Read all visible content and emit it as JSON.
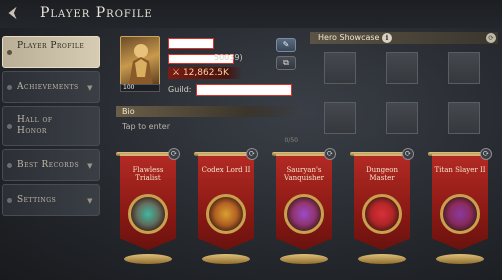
{
  "header": {
    "title": "Player Profile"
  },
  "sidebar": {
    "items": [
      {
        "label": "Player Profile",
        "active": true
      },
      {
        "label": "Achievements",
        "active": false
      },
      {
        "label": "Hall of Honor",
        "active": false
      },
      {
        "label": "Best Records",
        "active": false
      },
      {
        "label": "Settings",
        "active": false
      }
    ]
  },
  "profile": {
    "level": "100",
    "id_suffix": "50039)",
    "power": "12,862.5K",
    "guild_label": "Guild:"
  },
  "bio": {
    "label": "Bio",
    "placeholder": "Tap to enter",
    "count": "0/50"
  },
  "showcase": {
    "label": "Hero Showcase"
  },
  "banners": [
    {
      "title": "Flawless Trialist",
      "emblem_color": "#3fb8a0"
    },
    {
      "title": "Codex Lord II",
      "emblem_color": "#d8a030"
    },
    {
      "title": "Sauryan's Vanquisher",
      "emblem_color": "#9a4cc8"
    },
    {
      "title": "Dungeon Master",
      "emblem_color": "#d8303a"
    },
    {
      "title": "Titan Slayer II",
      "emblem_color": "#8a3aa0"
    }
  ],
  "colors": {
    "accent_red": "#b32a24",
    "gold": "#c9a14e",
    "redaction": "#d9302a"
  }
}
